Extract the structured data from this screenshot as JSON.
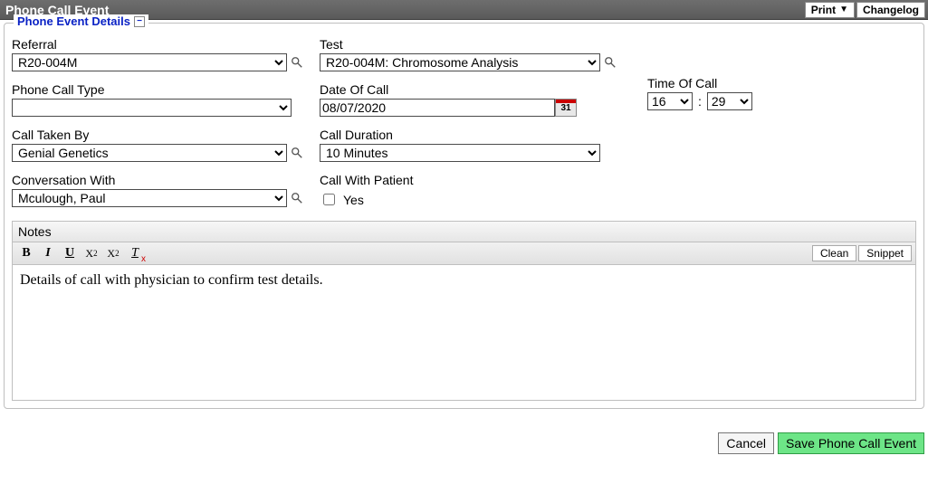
{
  "header": {
    "title": "Phone Call Event",
    "print_label": "Print",
    "changelog_label": "Changelog"
  },
  "fieldset_title": "Phone Event Details",
  "fields": {
    "referral": {
      "label": "Referral",
      "value": "R20-004M"
    },
    "test": {
      "label": "Test",
      "value": "R20-004M: Chromosome Analysis"
    },
    "phone_call_type": {
      "label": "Phone Call Type",
      "value": ""
    },
    "date_of_call": {
      "label": "Date Of Call",
      "value": "08/07/2020"
    },
    "time_of_call": {
      "label": "Time Of Call",
      "hour": "16",
      "minute": "29"
    },
    "call_taken_by": {
      "label": "Call Taken By",
      "value": "Genial Genetics"
    },
    "call_duration": {
      "label": "Call Duration",
      "value": "10 Minutes"
    },
    "conversation_with": {
      "label": "Conversation With",
      "value": "Mculough, Paul"
    },
    "call_with_patient": {
      "label": "Call With Patient",
      "checkbox_label": "Yes",
      "checked": false
    }
  },
  "notes": {
    "header": "Notes",
    "clean_label": "Clean",
    "snippet_label": "Snippet",
    "content": "Details of call with physician to confirm test details."
  },
  "footer": {
    "cancel_label": "Cancel",
    "save_label": "Save Phone Call Event"
  },
  "calendar_day": "31"
}
